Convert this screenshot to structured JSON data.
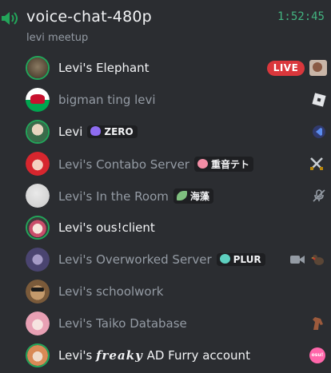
{
  "header": {
    "channel_name": "voice-chat-480p",
    "timer": "1:52:45",
    "subtitle": "levi meetup"
  },
  "users": [
    {
      "name": "Levi's Elephant",
      "active": true,
      "speaking": true,
      "live_label": "LIVE",
      "avatar": "elephant-avatar"
    },
    {
      "name": "bigman ting levi",
      "active": false,
      "speaking": false,
      "avatar": "wales-flag-avatar",
      "status_icon": "roblox-icon"
    },
    {
      "name": "Levi",
      "active": true,
      "speaking": true,
      "tag": "ZERO",
      "tag_icon": "flame-icon",
      "avatar": "anime-girl-avatar",
      "status_icon": "vscode-icon"
    },
    {
      "name": "Levi's Contabo Server",
      "active": false,
      "speaking": false,
      "tag": "重音テト",
      "tag_icon": "heart-icon",
      "avatar": "red-hair-avatar",
      "status_icon": "crossed-swords-icon"
    },
    {
      "name": "Levi's In the Room",
      "active": false,
      "speaking": false,
      "tag": "海藻",
      "tag_icon": "leaf-icon",
      "avatar": "white-circle-avatar",
      "status_icon": "muted-icon"
    },
    {
      "name": "Levi's ous!client",
      "active": true,
      "speaking": true,
      "avatar": "anime-avatar",
      "status_icon": ""
    },
    {
      "name": "Levi's Overworked Server",
      "active": false,
      "speaking": false,
      "tag": "PLUR",
      "tag_icon": "heart-icon",
      "avatar": "dark-anime-avatar",
      "status_icon": "camera-icon"
    },
    {
      "name": "Levi's schoolwork",
      "active": false,
      "speaking": false,
      "avatar": "dog-avatar",
      "status_icon": ""
    },
    {
      "name": "Levi's Taiko Database",
      "active": false,
      "speaking": false,
      "avatar": "pink-hair-avatar",
      "status_icon": "horse-icon"
    },
    {
      "name_prefix": "Levi's ",
      "name_styled": "𝒇𝒓𝒆𝒂𝒌𝒚",
      "name_suffix": " AD Furry account",
      "active": true,
      "speaking": true,
      "avatar": "furry-avatar",
      "status_icon": "osu-icon",
      "status_text": "osu!"
    }
  ],
  "colors": {
    "background": "#2b2d31",
    "speaking_ring": "#23a55a",
    "live_badge": "#da373c",
    "timer": "#43b581"
  }
}
